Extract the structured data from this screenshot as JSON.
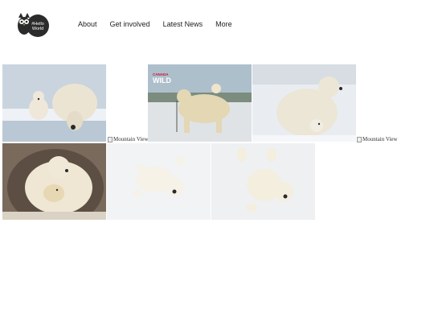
{
  "brand": {
    "logo_text_line1": "#Hello",
    "logo_text_line2": "World"
  },
  "nav": {
    "items": [
      {
        "label": "About"
      },
      {
        "label": "Get involved"
      },
      {
        "label": "Latest News"
      },
      {
        "label": "More"
      }
    ]
  },
  "gallery": {
    "photos": [
      {
        "subject": "polar-bear-mother-and-cub-on-ice"
      },
      {
        "subject": "canada-wild-polar-bear-carrying-cub",
        "watermark_line1": "CANADA",
        "watermark_line2": "WILD"
      },
      {
        "subject": "polar-bear-sitting-with-cub-in-snow"
      },
      {
        "subject": "polar-bear-and-cub-in-den"
      },
      {
        "subject": "polar-bear-cub-rolling-in-snow"
      },
      {
        "subject": "polar-bear-cub-playing-on-back"
      }
    ],
    "broken_images": [
      {
        "alt": "Mountain View"
      },
      {
        "alt": "Mountain View"
      }
    ]
  },
  "colors": {
    "snow": "#eef1f5",
    "bear": "#e9e1cf",
    "sky": "#aebfcc",
    "rock": "#7a6a5c"
  }
}
